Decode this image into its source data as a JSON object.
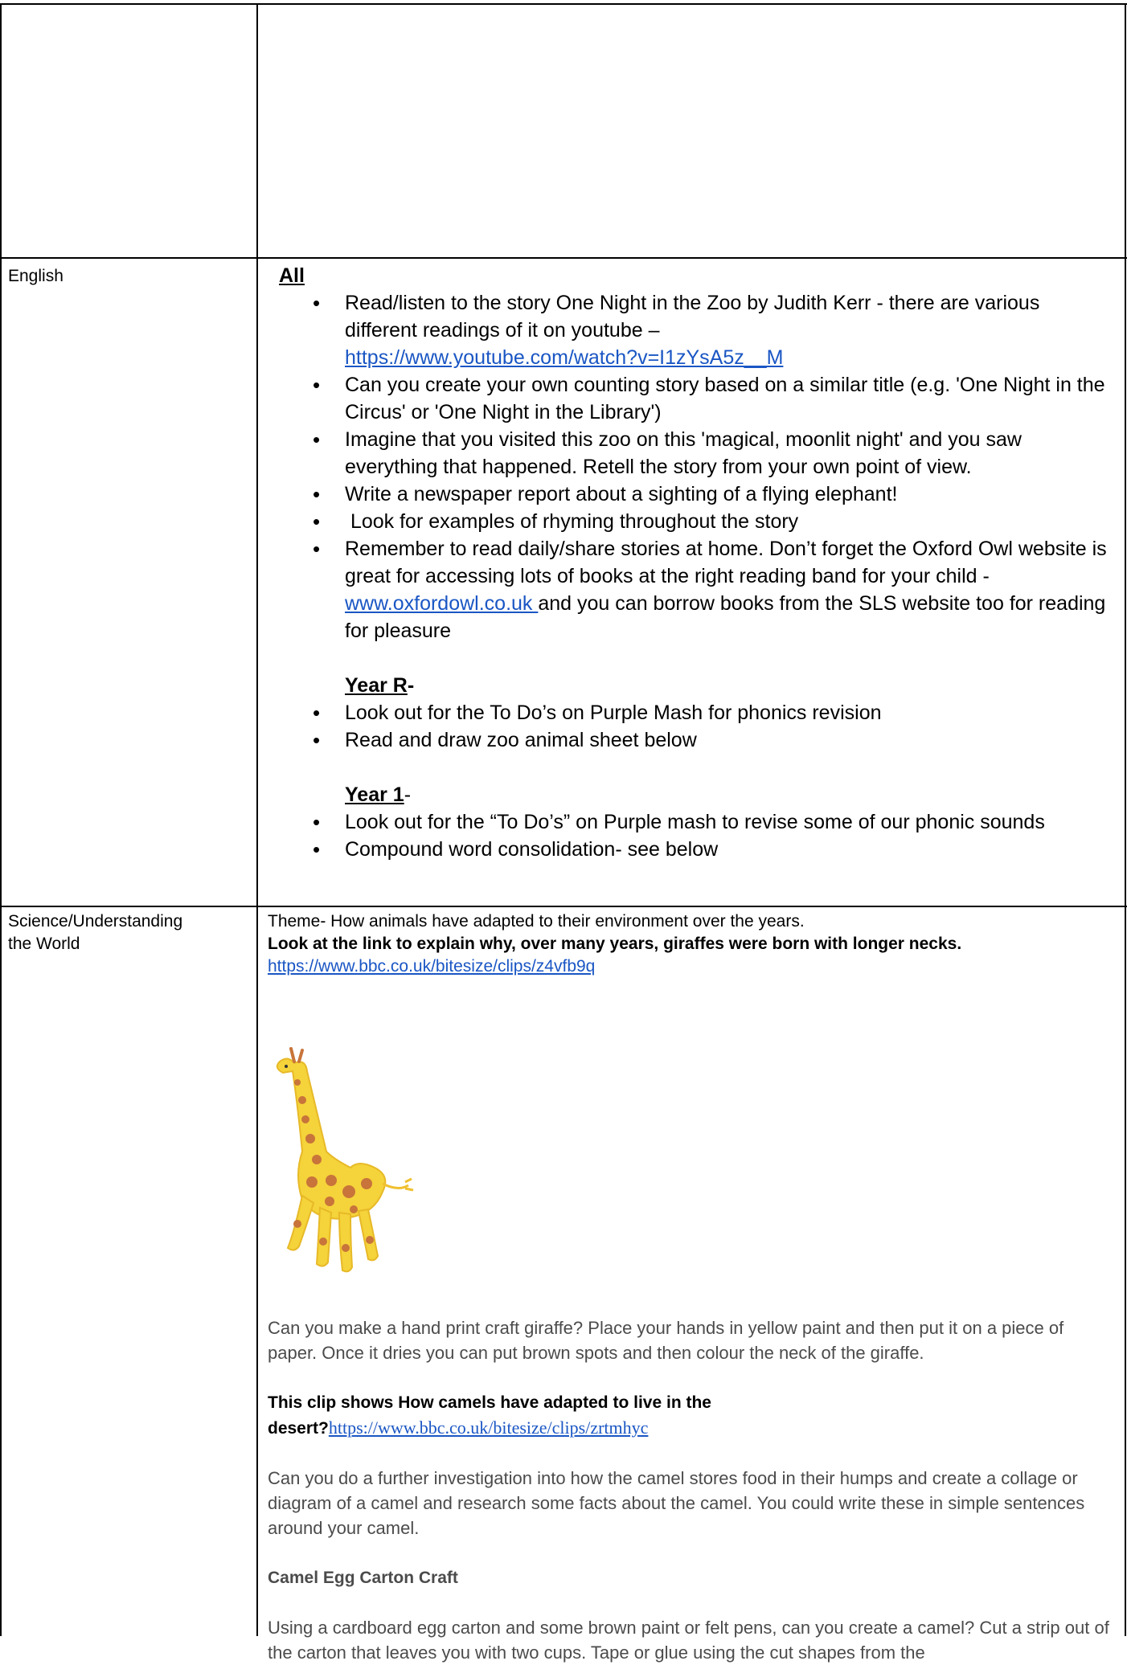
{
  "english": {
    "subject": "English",
    "all_heading": "All",
    "all_items": [
      "Read/listen to the story One Night in the Zoo by Judith Kerr - there are various different readings of it on youtube –",
      "Can you create your own counting story based on a similar title (e.g. 'One Night in the Circus' or 'One Night in the Library')",
      "Imagine that you visited this zoo on this 'magical, moonlit night' and you saw everything that happened. Retell the story from your own point of view.",
      "Write a newspaper report about a sighting of a flying elephant!",
      " Look for examples of rhyming throughout the story"
    ],
    "youtube_link": "https://www.youtube.com/watch?v=I1zYsA5z__M",
    "reading_text_1": "Remember to read daily/share stories at home. Don’t forget the Oxford Owl website is great for accessing lots of books at the right reading band for your child - ",
    "oxford_link": "www.oxfordowl.co.uk ",
    "reading_text_2": "and you can borrow books from the SLS website too for reading for pleasure",
    "year_r_heading": "Year R",
    "year_r_suffix": "-",
    "year_r_items": [
      "Look out for the To Do’s on Purple Mash for phonics revision",
      "Read and draw zoo animal sheet below"
    ],
    "year_1_heading": "Year 1",
    "year_1_suffix": "-",
    "year_1_items": [
      "Look out for the “To Do’s” on Purple mash to revise some of our phonic sounds",
      "Compound word consolidation- see below"
    ]
  },
  "science": {
    "subject_line_1": "Science/Understanding",
    "subject_line_2": "the World",
    "theme": "Theme- How animals have adapted to their environment over the years.",
    "giraffe_question": "Look at the link to explain why, over many years, giraffes were born with longer necks.",
    "giraffe_link": "https://www.bbc.co.uk/bitesize/clips/z4vfb9q",
    "handprint_text": "Can you make a hand print craft giraffe? Place your hands in yellow paint and then put it on a piece of paper. Once it dries you can put brown spots and then colour the neck of the giraffe.",
    "camel_clip_text": "This clip shows How camels have adapted to live in the desert?",
    "camel_link": "https://www.bbc.co.uk/bitesize/clips/zrtmhyc",
    "camel_investigation": "Can you do a further investigation into how the camel stores food in their humps and create a collage or diagram of a camel and research some facts about the camel. You could write these in simple sentences around your camel.",
    "camel_craft_heading": "Camel Egg Carton Craft",
    "camel_craft_text": "Using a cardboard egg carton and some brown paint or felt pens, can you create a camel? Cut a strip out of the carton that leaves you with two cups. Tape or glue using the cut shapes from the"
  },
  "colors": {
    "link": "#1a56c4",
    "giraffe_yellow": "#f5d33a",
    "giraffe_spot": "#c8743a"
  }
}
